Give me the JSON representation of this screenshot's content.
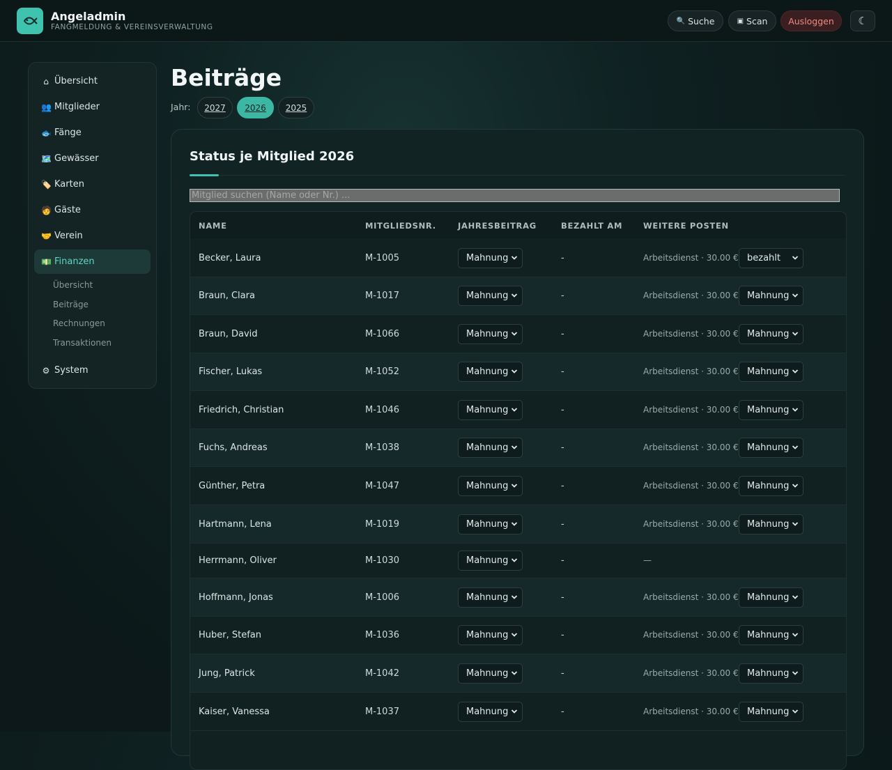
{
  "header": {
    "app_name": "Angeladmin",
    "subtitle": "FANGMELDUNG & VEREINSVERWALTUNG",
    "search_label": "Suche",
    "scan_label": "Scan",
    "logout_label": "Ausloggen",
    "theme_glyph": "☾",
    "search_glyph": "🔍",
    "scan_glyph": "▣"
  },
  "sidebar": {
    "items": [
      {
        "icon": "⌂",
        "label": "Übersicht"
      },
      {
        "icon": "👥",
        "label": "Mitglieder"
      },
      {
        "icon": "🐟",
        "label": "Fänge"
      },
      {
        "icon": "🗺️",
        "label": "Gewässer"
      },
      {
        "icon": "🏷️",
        "label": "Karten"
      },
      {
        "icon": "🧑",
        "label": "Gäste"
      },
      {
        "icon": "🤝",
        "label": "Verein"
      },
      {
        "icon": "💵",
        "label": "Finanzen"
      }
    ],
    "sub_items": [
      "Übersicht",
      "Beiträge",
      "Rechnungen",
      "Transaktionen"
    ],
    "system": {
      "icon": "⚙",
      "label": "System"
    }
  },
  "main": {
    "title": "Beiträge",
    "year_label": "Jahr:",
    "years": [
      "2027",
      "2026",
      "2025"
    ],
    "selected_year": "2026",
    "card_title": "Status je Mitglied 2026",
    "search_placeholder": "Mitglied suchen (Name oder Nr.) ...",
    "columns": [
      "NAME",
      "MITGLIEDSNR.",
      "JAHRESBEITRAG",
      "BEZAHLT AM",
      "WEITERE POSTEN"
    ],
    "rows": [
      {
        "name": "Becker, Laura",
        "nr": "M-1005",
        "beitrag": "Mahnung",
        "bezahlt": "-",
        "posten": "Arbeitsdienst · 30.00 €",
        "posten_status": "bezahlt"
      },
      {
        "name": "Braun, Clara",
        "nr": "M-1017",
        "beitrag": "Mahnung",
        "bezahlt": "-",
        "posten": "Arbeitsdienst · 30.00 €",
        "posten_status": "Mahnung"
      },
      {
        "name": "Braun, David",
        "nr": "M-1066",
        "beitrag": "Mahnung",
        "bezahlt": "-",
        "posten": "Arbeitsdienst · 30.00 €",
        "posten_status": "Mahnung"
      },
      {
        "name": "Fischer, Lukas",
        "nr": "M-1052",
        "beitrag": "Mahnung",
        "bezahlt": "-",
        "posten": "Arbeitsdienst · 30.00 €",
        "posten_status": "Mahnung"
      },
      {
        "name": "Friedrich, Christian",
        "nr": "M-1046",
        "beitrag": "Mahnung",
        "bezahlt": "-",
        "posten": "Arbeitsdienst · 30.00 €",
        "posten_status": "Mahnung"
      },
      {
        "name": "Fuchs, Andreas",
        "nr": "M-1038",
        "beitrag": "Mahnung",
        "bezahlt": "-",
        "posten": "Arbeitsdienst · 30.00 €",
        "posten_status": "Mahnung"
      },
      {
        "name": "Günther, Petra",
        "nr": "M-1047",
        "beitrag": "Mahnung",
        "bezahlt": "-",
        "posten": "Arbeitsdienst · 30.00 €",
        "posten_status": "Mahnung"
      },
      {
        "name": "Hartmann, Lena",
        "nr": "M-1019",
        "beitrag": "Mahnung",
        "bezahlt": "-",
        "posten": "Arbeitsdienst · 30.00 €",
        "posten_status": "Mahnung"
      },
      {
        "name": "Herrmann, Oliver",
        "nr": "M-1030",
        "beitrag": "Mahnung",
        "bezahlt": "-",
        "posten": "—",
        "posten_status": ""
      },
      {
        "name": "Hoffmann, Jonas",
        "nr": "M-1006",
        "beitrag": "Mahnung",
        "bezahlt": "-",
        "posten": "Arbeitsdienst · 30.00 €",
        "posten_status": "Mahnung"
      },
      {
        "name": "Huber, Stefan",
        "nr": "M-1036",
        "beitrag": "Mahnung",
        "bezahlt": "-",
        "posten": "Arbeitsdienst · 30.00 €",
        "posten_status": "Mahnung"
      },
      {
        "name": "Jung, Patrick",
        "nr": "M-1042",
        "beitrag": "Mahnung",
        "bezahlt": "-",
        "posten": "Arbeitsdienst · 30.00 €",
        "posten_status": "Mahnung"
      },
      {
        "name": "Kaiser, Vanessa",
        "nr": "M-1037",
        "beitrag": "Mahnung",
        "bezahlt": "-",
        "posten": "Arbeitsdienst · 30.00 €",
        "posten_status": "Mahnung"
      }
    ]
  },
  "colors": {
    "accent": "#3fc2ae",
    "background": "#0d1a1b",
    "logout": "#f08a85"
  }
}
